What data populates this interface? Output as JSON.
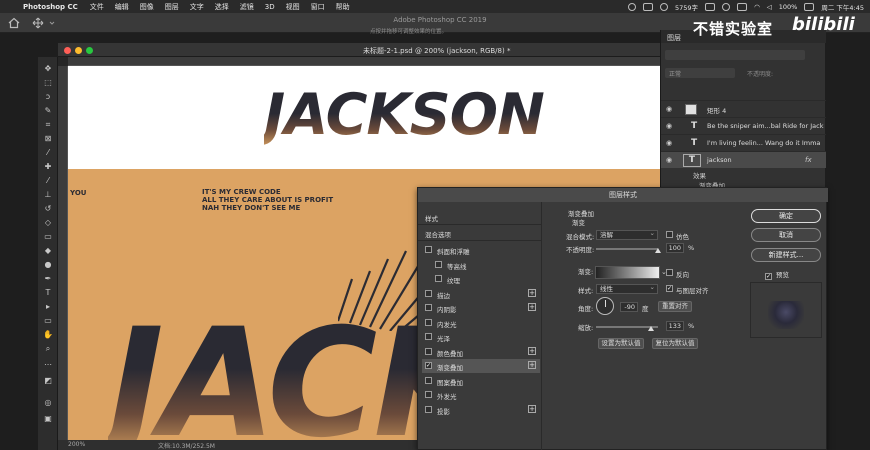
{
  "menubar": {
    "app": "Photoshop CC",
    "items": [
      "文件",
      "编辑",
      "图像",
      "图层",
      "文字",
      "选择",
      "滤镜",
      "3D",
      "视图",
      "窗口",
      "帮助"
    ],
    "status_value": "5759字",
    "battery": "100%",
    "datetime": "周二 下午4:45"
  },
  "window": {
    "title": "Adobe Photoshop CC 2019",
    "hint": "点按并拖移可调整效果的位置。"
  },
  "document": {
    "tab_title": "未标题-2-1.psd @ 200% (jackson, RGB/8) *",
    "zoom": "200%",
    "doc_size": "文档:10.3M/252.5M",
    "heading_text": "JACKSON",
    "side_text": "YOU",
    "lyrics": [
      "IT'S MY CREW CODE",
      "ALL THEY CARE ABOUT IS PROFIT",
      "NAH THEY DON'T SEE ME"
    ],
    "big_text": "JACK"
  },
  "layers_panel": {
    "tab": "图层",
    "mode": "正常",
    "opacity_label": "不透明度:",
    "layers": [
      {
        "name": "矩形 4",
        "kind": "shape"
      },
      {
        "name": "Be the sniper aim...bal Ride for Jack",
        "kind": "text"
      },
      {
        "name": "I'm living feelin... Wang do it Imma",
        "kind": "text"
      },
      {
        "name": "jackson",
        "kind": "text",
        "fx": "fx"
      }
    ],
    "effects_label": "效果",
    "effect_item": "渐变叠加"
  },
  "watermark": {
    "text": "不错实验室",
    "brand": "bilibili"
  },
  "dialog": {
    "title": "图层样式",
    "left_items": [
      {
        "label": "样式",
        "checkbox": false,
        "plus": false
      },
      {
        "label": "混合选项",
        "checkbox": false,
        "plus": false
      },
      {
        "label": "斜面和浮雕",
        "checkbox": true,
        "checked": false,
        "plus": false
      },
      {
        "label": "等高线",
        "checkbox": true,
        "checked": false,
        "plus": false,
        "indent": true
      },
      {
        "label": "纹理",
        "checkbox": true,
        "checked": false,
        "plus": false,
        "indent": true
      },
      {
        "label": "描边",
        "checkbox": true,
        "checked": false,
        "plus": true
      },
      {
        "label": "内阴影",
        "checkbox": true,
        "checked": false,
        "plus": true
      },
      {
        "label": "内发光",
        "checkbox": true,
        "checked": false,
        "plus": false
      },
      {
        "label": "光泽",
        "checkbox": true,
        "checked": false,
        "plus": false
      },
      {
        "label": "颜色叠加",
        "checkbox": true,
        "checked": false,
        "plus": true
      },
      {
        "label": "渐变叠加",
        "checkbox": true,
        "checked": true,
        "plus": true
      },
      {
        "label": "图案叠加",
        "checkbox": true,
        "checked": false,
        "plus": false
      },
      {
        "label": "外发光",
        "checkbox": true,
        "checked": false,
        "plus": false
      },
      {
        "label": "投影",
        "checkbox": true,
        "checked": false,
        "plus": true
      }
    ],
    "footer": "fx",
    "section_title": "渐变叠加",
    "section_sub": "渐变",
    "blend_label": "混合模式:",
    "blend_value": "溶解",
    "dither_label": "仿色",
    "opacity_label": "不透明度:",
    "opacity_value": "100",
    "opacity_fraction": 1.0,
    "gradient_label": "渐变:",
    "reverse_label": "反向",
    "style_label": "样式:",
    "style_value": "线性",
    "align_label": "与图层对齐",
    "angle_label": "角度:",
    "angle_value": "-90",
    "angle_unit": "度",
    "reset_align": "重置对齐",
    "scale_label": "缩放:",
    "scale_value": "133",
    "scale_fraction": 0.89,
    "percent": "%",
    "set_default": "设置为默认值",
    "reset_default": "复位为默认值",
    "ok": "确定",
    "cancel": "取消",
    "new_style": "新建样式...",
    "preview": "预览"
  }
}
